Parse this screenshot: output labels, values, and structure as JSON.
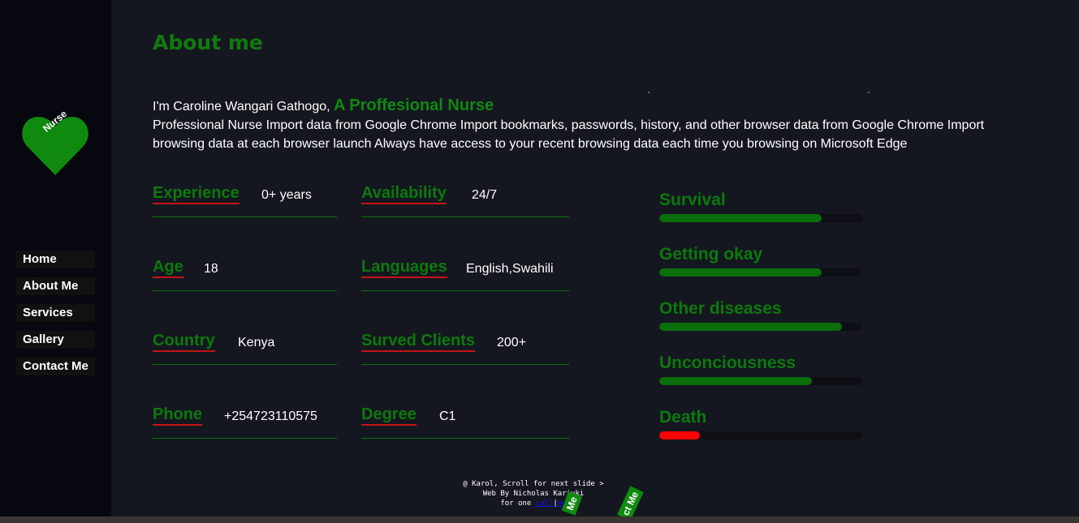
{
  "sidebar": {
    "logo_text": "Nurse",
    "nav": [
      {
        "label": "Home"
      },
      {
        "label": "About Me"
      },
      {
        "label": "Services"
      },
      {
        "label": "Gallery"
      },
      {
        "label": "Contact Me"
      }
    ]
  },
  "main": {
    "title": "About me",
    "intro": {
      "prefix": "I'm Caroline Wangari Gathogo,",
      "role": "A Proffesional Nurse",
      "description": "Professional Nurse Import data from Google Chrome Import bookmarks, passwords, history, and other browser data from Google Chrome Import browsing data at each browser launch Always have access to your recent browsing data each time you browsing on Microsoft Edge"
    },
    "info": [
      {
        "label": "Experience",
        "value": "0+ years"
      },
      {
        "label": "Availability",
        "value": "24/7"
      },
      {
        "label": "Age",
        "value": "18"
      },
      {
        "label": "Languages",
        "value": "English,Swahili"
      },
      {
        "label": "Country",
        "value": "Kenya"
      },
      {
        "label": "Surved Clients",
        "value": "200+"
      },
      {
        "label": "Phone",
        "value": "+254723110575"
      },
      {
        "label": "Degree",
        "value": "C1"
      }
    ],
    "skills": [
      {
        "label": "Survival",
        "level": 0.8,
        "color": "#0a6e0a"
      },
      {
        "label": "Getting okay",
        "level": 0.8,
        "color": "#0a6e0a"
      },
      {
        "label": "Other diseases",
        "level": 0.9,
        "color": "#0a6e0a"
      },
      {
        "label": "Unconciousness",
        "level": 0.75,
        "color": "#0a6e0a"
      },
      {
        "label": "Death",
        "level": 0.2,
        "color": "#ff0000"
      }
    ]
  },
  "footer": {
    "line1": "@ Karol, Scroll for next slide >",
    "line2": "Web By Nicholas Kariuki",
    "line3_prefix": "for one",
    "link1": "call",
    "link2": "me"
  },
  "floating_tags": {
    "tag1": "Me",
    "tag2": "ct Me"
  },
  "colors": {
    "accent_green": "#0b7a0b",
    "underline_red": "#c21515",
    "background": "#151720",
    "sidebar": "#06070f"
  }
}
